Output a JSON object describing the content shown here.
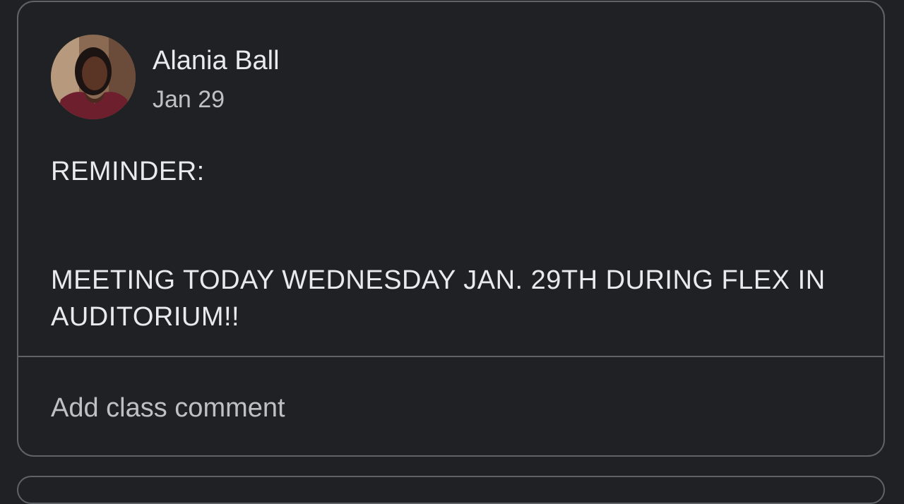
{
  "post": {
    "author": "Alania Ball",
    "date": "Jan 29",
    "avatar_icon": "user-avatar-photo",
    "body_line1": "REMINDER:",
    "body_line2": "MEETING TODAY WEDNESDAY JAN. 29TH DURING FLEX IN AUDITORIUM!!"
  },
  "comment": {
    "placeholder": "Add class comment"
  },
  "colors": {
    "background": "#202124",
    "border": "#5f6368",
    "primary_text": "#e8eaed",
    "secondary_text": "#bdc1c6"
  }
}
